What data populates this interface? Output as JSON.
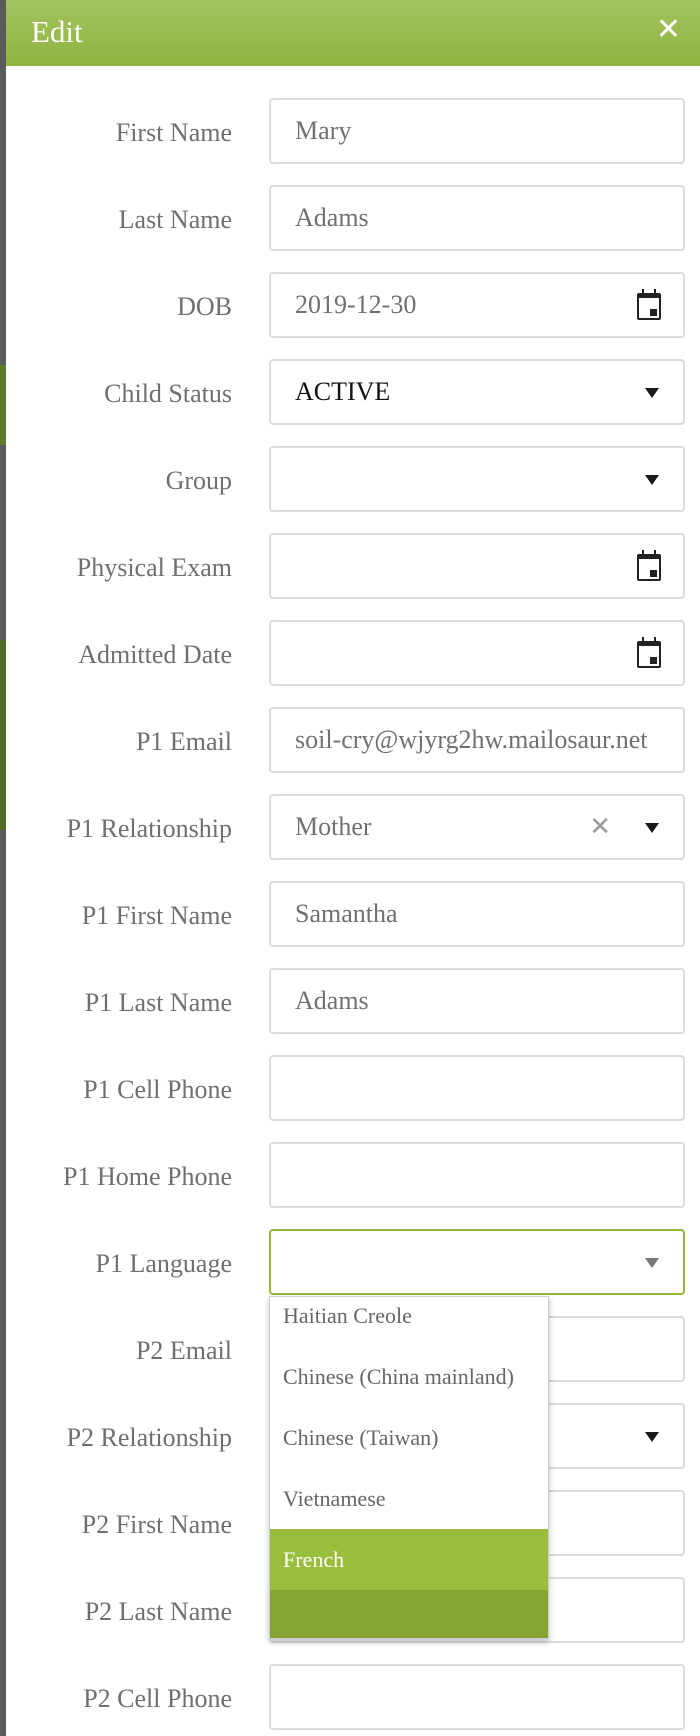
{
  "modal": {
    "title": "Edit",
    "close_icon": "close-icon"
  },
  "fields": {
    "first_name": {
      "label": "First Name",
      "value": "Mary"
    },
    "last_name": {
      "label": "Last Name",
      "value": "Adams"
    },
    "dob": {
      "label": "DOB",
      "value": "2019-12-30",
      "icon": "calendar-icon"
    },
    "child_status": {
      "label": "Child Status",
      "value": "ACTIVE"
    },
    "group": {
      "label": "Group",
      "value": ""
    },
    "physical_exam": {
      "label": "Physical Exam",
      "value": "",
      "icon": "calendar-icon"
    },
    "admitted_date": {
      "label": "Admitted Date",
      "value": "",
      "icon": "calendar-icon"
    },
    "p1_email": {
      "label": "P1 Email",
      "value": "soil-cry@wjyrg2hw.mailosaur.net"
    },
    "p1_relationship": {
      "label": "P1 Relationship",
      "value": "Mother"
    },
    "p1_first_name": {
      "label": "P1 First Name",
      "value": "Samantha"
    },
    "p1_last_name": {
      "label": "P1 Last Name",
      "value": "Adams"
    },
    "p1_cell_phone": {
      "label": "P1 Cell Phone",
      "value": ""
    },
    "p1_home_phone": {
      "label": "P1 Home Phone",
      "value": ""
    },
    "p1_language": {
      "label": "P1 Language",
      "value": ""
    },
    "p2_email": {
      "label": "P2 Email",
      "value": ""
    },
    "p2_relationship": {
      "label": "P2 Relationship",
      "value": ""
    },
    "p2_first_name": {
      "label": "P2 First Name",
      "value": ""
    },
    "p2_last_name": {
      "label": "P2 Last Name",
      "value": ""
    },
    "p2_cell_phone": {
      "label": "P2 Cell Phone",
      "value": ""
    }
  },
  "language_dropdown": {
    "options": [
      "Haitian Creole",
      "Chinese (China mainland)",
      "Chinese (Taiwan)",
      "Vietnamese",
      "French",
      ""
    ],
    "highlighted": "French",
    "colors": {
      "highlight": "#9abd3c",
      "next": "#84a531"
    }
  },
  "colors": {
    "header": "#96b94a",
    "focus_border": "#94b83f",
    "label_text": "#6f6f6f"
  }
}
